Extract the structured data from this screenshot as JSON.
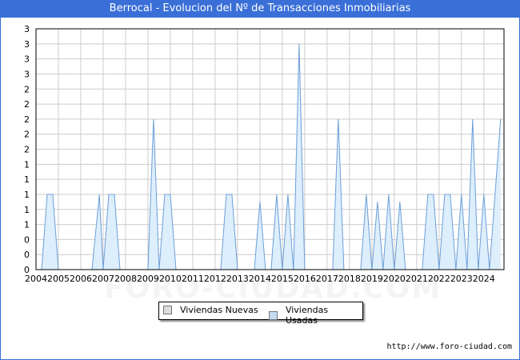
{
  "title": "Berrocal - Evolucion del Nº de Transacciones Inmobiliarias",
  "footer": "http://www.foro-ciudad.com",
  "watermark": "FORO-CIUDAD.COM",
  "legend": [
    {
      "label": "Viviendas Nuevas",
      "color": "#dddddd"
    },
    {
      "label": "Viviendas Usadas",
      "color": "#c6dcf5"
    }
  ],
  "colors": {
    "title_bg": "#3a6fd8",
    "usadas_fill": "#ddeefc",
    "usadas_line": "#6d9fd8",
    "grid": "#cccccc"
  },
  "chart_data": {
    "type": "area",
    "title": "Berrocal - Evolucion del Nº de Transacciones Inmobiliarias",
    "xlabel": "",
    "ylabel": "",
    "xlim": [
      2004,
      2024.9
    ],
    "ylim": [
      0,
      3.2
    ],
    "y_tick_values": [
      0,
      0.2,
      0.4,
      0.6,
      0.8,
      1,
      1.2,
      1.4,
      1.6,
      1.8,
      2,
      2.2,
      2.4,
      2.6,
      2.8,
      3,
      3.2
    ],
    "y_tick_labels": [
      "0",
      "0",
      "0",
      "1",
      "1",
      "1",
      "1",
      "1",
      "2",
      "2",
      "2",
      "2",
      "2",
      "3",
      "3",
      "3",
      "3"
    ],
    "x_tick_labels": [
      "2004",
      "2005",
      "2006",
      "2007",
      "2008",
      "2009",
      "2010",
      "2011",
      "2012",
      "2013",
      "2014",
      "2015",
      "2016",
      "2017",
      "2018",
      "2019",
      "2020",
      "2021",
      "2022",
      "2023",
      "2024"
    ],
    "grid": true,
    "legend_position": "bottom-center",
    "series": [
      {
        "name": "Viviendas Nuevas",
        "points": []
      },
      {
        "name": "Viviendas Usadas",
        "points": [
          [
            2004.25,
            0
          ],
          [
            2004.5,
            1
          ],
          [
            2004.75,
            1
          ],
          [
            2005.0,
            0
          ],
          [
            2006.5,
            0
          ],
          [
            2006.83,
            1
          ],
          [
            2007.0,
            0
          ],
          [
            2007.25,
            1
          ],
          [
            2007.5,
            1
          ],
          [
            2007.75,
            0
          ],
          [
            2009.0,
            0
          ],
          [
            2009.25,
            2
          ],
          [
            2009.5,
            0
          ],
          [
            2009.75,
            1
          ],
          [
            2010.0,
            1
          ],
          [
            2010.25,
            0
          ],
          [
            2012.25,
            0
          ],
          [
            2012.5,
            1
          ],
          [
            2012.75,
            1
          ],
          [
            2013.0,
            0
          ],
          [
            2013.75,
            0
          ],
          [
            2014.0,
            0.9
          ],
          [
            2014.25,
            0
          ],
          [
            2014.5,
            0
          ],
          [
            2014.75,
            1
          ],
          [
            2015.0,
            0
          ],
          [
            2015.25,
            1
          ],
          [
            2015.5,
            0
          ],
          [
            2015.75,
            3
          ],
          [
            2016.0,
            0
          ],
          [
            2017.25,
            0
          ],
          [
            2017.5,
            2
          ],
          [
            2017.75,
            0
          ],
          [
            2018.5,
            0
          ],
          [
            2018.75,
            1
          ],
          [
            2019.0,
            0
          ],
          [
            2019.25,
            0.9
          ],
          [
            2019.5,
            0
          ],
          [
            2019.75,
            1
          ],
          [
            2020.0,
            0
          ],
          [
            2020.25,
            0.9
          ],
          [
            2020.5,
            0
          ],
          [
            2021.25,
            0
          ],
          [
            2021.5,
            1
          ],
          [
            2021.75,
            1
          ],
          [
            2022.0,
            0
          ],
          [
            2022.25,
            1
          ],
          [
            2022.5,
            1
          ],
          [
            2022.75,
            0
          ],
          [
            2023.0,
            1
          ],
          [
            2023.25,
            0
          ],
          [
            2023.5,
            2
          ],
          [
            2023.75,
            0
          ],
          [
            2024.0,
            1
          ],
          [
            2024.25,
            0
          ],
          [
            2024.75,
            2
          ]
        ]
      }
    ]
  }
}
